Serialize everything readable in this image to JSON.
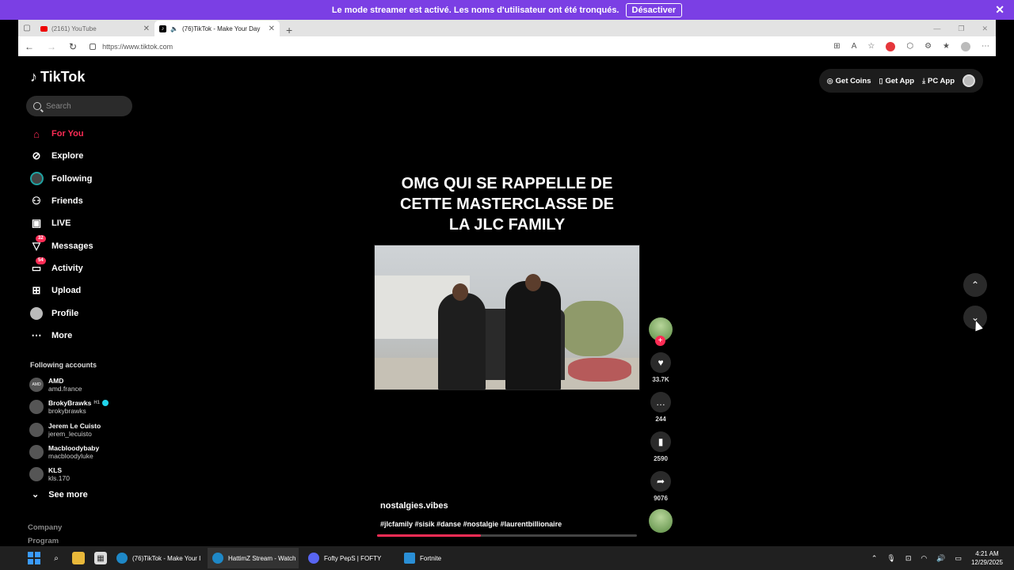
{
  "streamer_banner": {
    "message": "Le mode streamer est activé. Les noms d'utilisateur ont été tronqués.",
    "button": "Désactiver",
    "close": "✕"
  },
  "browser": {
    "tabs": [
      {
        "title": "(2161) YouTube",
        "close": "✕"
      },
      {
        "title": "(76)TikTok - Make Your Day",
        "close": "✕"
      }
    ],
    "new_tab": "+",
    "url": "https://www.tiktok.com"
  },
  "tiktok": {
    "logo": "TikTok",
    "search_placeholder": "Search",
    "nav": [
      {
        "label": "For You",
        "icon": "home-icon"
      },
      {
        "label": "Explore",
        "icon": "compass-icon"
      },
      {
        "label": "Following",
        "icon": "following-avatar-icon"
      },
      {
        "label": "Friends",
        "icon": "friends-icon"
      },
      {
        "label": "LIVE",
        "icon": "live-icon"
      },
      {
        "label": "Messages",
        "icon": "messages-icon",
        "badge": "32"
      },
      {
        "label": "Activity",
        "icon": "activity-icon",
        "badge": "54"
      },
      {
        "label": "Upload",
        "icon": "upload-icon"
      },
      {
        "label": "Profile",
        "icon": "profile-icon"
      },
      {
        "label": "More",
        "icon": "more-icon"
      }
    ],
    "following_heading": "Following accounts",
    "accounts": [
      {
        "name": "AMD",
        "handle": "amd.france",
        "avatar_text": "AMD"
      },
      {
        "name": "BrokyBrawks",
        "handle": "brokybrawks",
        "suffix": "H1"
      },
      {
        "name": "Jerem Le Cuisto",
        "handle": "jerem_lecuisto"
      },
      {
        "name": "Macbloodybaby",
        "handle": "macbloodyluke"
      },
      {
        "name": "KLS",
        "handle": "kls.170"
      }
    ],
    "see_more": "See more",
    "footer": [
      "Company",
      "Program"
    ],
    "top_right": {
      "coins": "Get Coins",
      "app": "Get App",
      "pc_app": "PC App"
    },
    "video": {
      "title": "OMG QUI SE RAPPELLE DE\nCETTE MASTERCLASSE DE\nLA JLC FAMILY",
      "username": "nostalgies.vibes",
      "tags": "#jlcfamily #sisik #danse #nostalgie #laurentbillionaire",
      "progress_percent": 40
    },
    "actions": {
      "likes": "33.7K",
      "comments": "244",
      "saves": "2590",
      "shares": "9076"
    }
  },
  "taskbar": {
    "apps": [
      {
        "label": "(76)TikTok - Make Your I",
        "color": "#1e88c7"
      },
      {
        "label": "HattimZ Stream - Watch",
        "color": "#1e88c7"
      },
      {
        "label": "Fofty PepS | FOFTY",
        "color": "#5865f2"
      },
      {
        "label": "Fortnite",
        "color": "#2a8fd6"
      }
    ],
    "time": "4:21 AM",
    "date": "12/29/2025"
  }
}
